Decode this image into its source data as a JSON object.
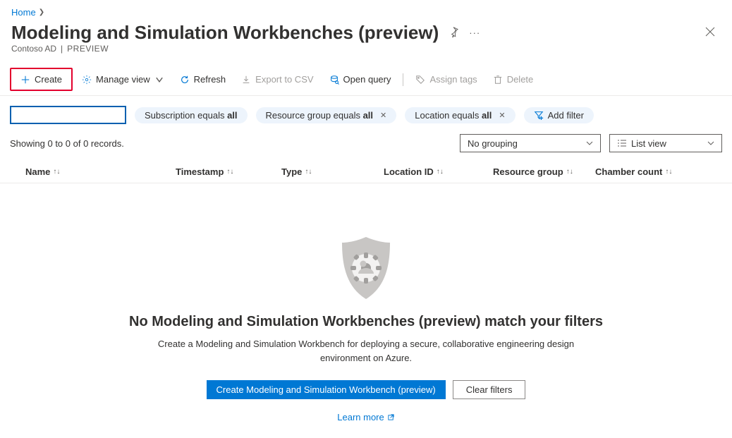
{
  "breadcrumb": {
    "home": "Home"
  },
  "header": {
    "title": "Modeling and Simulation Workbenches (preview)",
    "org": "Contoso AD",
    "preview_badge": "PREVIEW"
  },
  "toolbar": {
    "create": "Create",
    "manage_view": "Manage view",
    "refresh": "Refresh",
    "export_csv": "Export to CSV",
    "open_query": "Open query",
    "assign_tags": "Assign tags",
    "delete": "Delete"
  },
  "filters": {
    "subscription_prefix": "Subscription equals ",
    "subscription_value": "all",
    "rg_prefix": "Resource group equals ",
    "rg_value": "all",
    "location_prefix": "Location equals ",
    "location_value": "all",
    "add_filter": "Add filter"
  },
  "controls": {
    "records": "Showing 0 to 0 of 0 records.",
    "grouping": "No grouping",
    "view": "List view"
  },
  "columns": {
    "name": "Name",
    "timestamp": "Timestamp",
    "type": "Type",
    "location": "Location ID",
    "rg": "Resource group",
    "chamber": "Chamber count"
  },
  "empty": {
    "title": "No Modeling and Simulation Workbenches (preview) match your filters",
    "desc": "Create a Modeling and Simulation Workbench for deploying a secure, collaborative engineering design environment on Azure.",
    "create_btn": "Create Modeling and Simulation Workbench (preview)",
    "clear_btn": "Clear filters",
    "learn_more": "Learn more"
  }
}
